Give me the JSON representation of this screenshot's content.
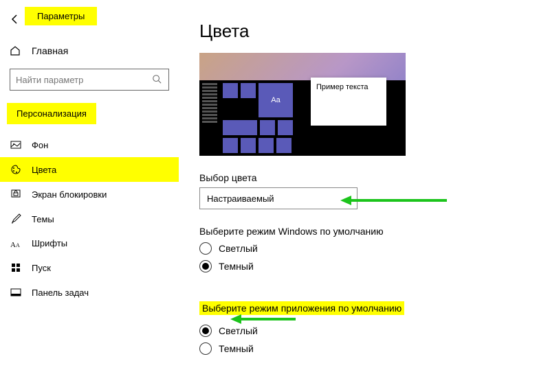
{
  "app_title": "Параметры",
  "home_label": "Главная",
  "search_placeholder": "Найти параметр",
  "section_label": "Персонализация",
  "nav": [
    {
      "label": "Фон"
    },
    {
      "label": "Цвета"
    },
    {
      "label": "Экран блокировки"
    },
    {
      "label": "Темы"
    },
    {
      "label": "Шрифты"
    },
    {
      "label": "Пуск"
    },
    {
      "label": "Панель задач"
    }
  ],
  "page_title": "Цвета",
  "preview_text": "Пример текста",
  "preview_tile_label": "Aa",
  "color_choice_label": "Выбор цвета",
  "color_choice_value": "Настраиваемый",
  "windows_mode_label": "Выберите режим Windows по умолчанию",
  "windows_mode_options": {
    "light": "Светлый",
    "dark": "Темный"
  },
  "app_mode_label": "Выберите режим приложения по умолчанию",
  "app_mode_options": {
    "light": "Светлый",
    "dark": "Темный"
  }
}
